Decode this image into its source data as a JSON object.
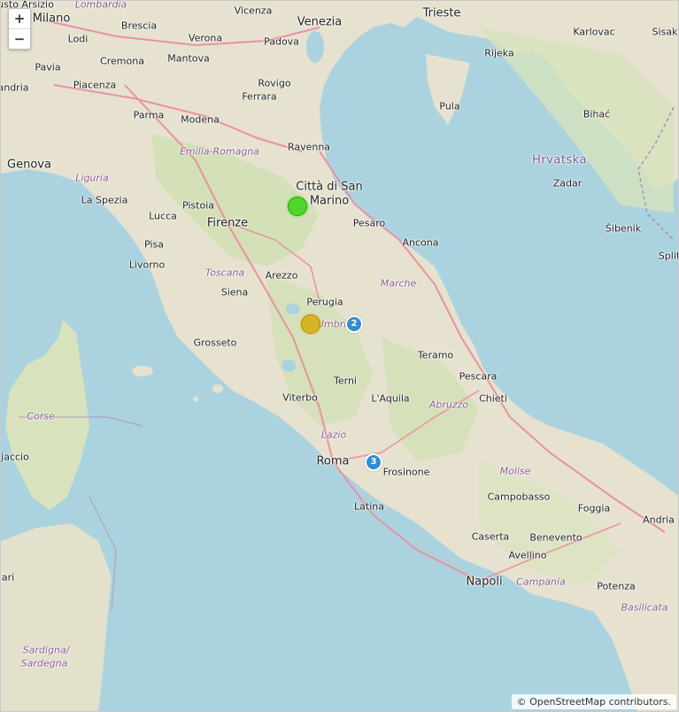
{
  "zoom": {
    "in_label": "+",
    "out_label": "−"
  },
  "attribution": "© OpenStreetMap contributors.",
  "labels": {
    "busto_arsizio": "usto Arsizio",
    "lombardia": "Lombardia",
    "vicenza": "Vicenza",
    "trieste": "Trieste",
    "milano": "Milano",
    "brescia": "Brescia",
    "venezia": "Venezia",
    "lodi": "Lodi",
    "verona": "Verona",
    "padova": "Padova",
    "karlovac": "Karlovac",
    "sisak": "Sisak",
    "cremona": "Cremona",
    "mantova": "Mantova",
    "pavia": "Pavia",
    "rijeka": "Rijeka",
    "piacenza": "Piacenza",
    "alessandria": "andria",
    "rovigo": "Rovigo",
    "ferrara": "Ferrara",
    "pula": "Pula",
    "parma": "Parma",
    "modena": "Modena",
    "bihac": "Bihać",
    "ravenna": "Ravenna",
    "emilia_romagna": "Emilia-Romagna",
    "genova": "Genova",
    "hrvatska": "Hrvatska",
    "liguria": "Liguria",
    "citta_san_marino_1": "Città di San",
    "citta_san_marino_2": "Marino",
    "zadar": "Zadar",
    "la_spezia": "La Spezia",
    "pistoia": "Pistoia",
    "lucca": "Lucca",
    "firenze": "Firenze",
    "pesaro": "Pesaro",
    "sibenik": "Šibenik",
    "ancona": "Ancona",
    "split": "Split",
    "pisa": "Pisa",
    "livorno": "Livorno",
    "arezzo": "Arezzo",
    "toscana": "Toscana",
    "marche": "Marche",
    "siena": "Siena",
    "perugia": "Perugia",
    "umbria": "Umbria",
    "grosseto": "Grosseto",
    "teramo": "Teramo",
    "pescara": "Pescara",
    "terni": "Terni",
    "corse": "Corse",
    "chieti": "Chieti",
    "laquila": "L'Aquila",
    "viterbo": "Viterbo",
    "abruzzo": "Abruzzo",
    "ajaccio": "jaccio",
    "lazio": "Lazio",
    "roma": "Roma",
    "frosinone": "Frosinone",
    "molise": "Molise",
    "campobasso": "Campobasso",
    "foggia": "Foggia",
    "latina": "Latina",
    "andria": "Andria",
    "caserta": "Caserta",
    "benevento": "Benevento",
    "avellino": "Avellino",
    "ari": "ari",
    "napoli": "Napoli",
    "campania": "Campania",
    "potenza": "Potenza",
    "basilicata": "Basilicata",
    "sardegna_1": "Sardigna/",
    "sardegna_2": "Sardegna"
  },
  "markers": {
    "cluster_umbria": "2",
    "cluster_roma": "3"
  }
}
